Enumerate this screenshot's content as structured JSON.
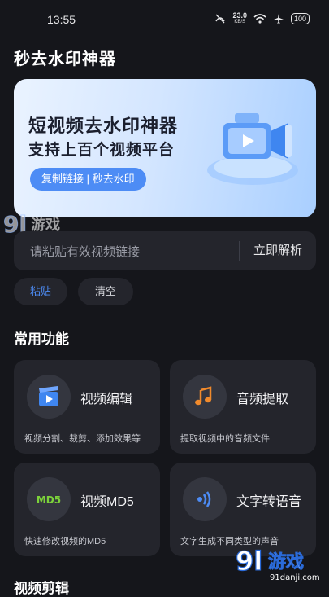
{
  "status_bar": {
    "time": "13:55",
    "speed_value": "23.0",
    "speed_unit": "KB/S",
    "battery": "100"
  },
  "app": {
    "title": "秒去水印神器"
  },
  "banner": {
    "headline": "短视频去水印神器",
    "subheadline": "支持上百个视频平台",
    "pill": "复制链接 | 秒去水印"
  },
  "watermark": {
    "brand": "9l游戏",
    "url": "91danji.com"
  },
  "url_input": {
    "placeholder": "请粘贴有效视频链接",
    "value": ""
  },
  "parse_button": "立即解析",
  "chips": {
    "paste": "粘贴",
    "clear": "清空"
  },
  "section_title": "常用功能",
  "features": [
    {
      "name": "视频编辑",
      "desc": "视频分割、裁剪、添加效果等",
      "icon": "clapperboard-play-icon"
    },
    {
      "name": "音频提取",
      "desc": "提取视频中的音频文件",
      "icon": "music-note-icon"
    },
    {
      "name": "视频MD5",
      "desc": "快速修改视频的MD5",
      "icon": "md5-badge-icon"
    },
    {
      "name": "文字转语音",
      "desc": "文字生成不同类型的声音",
      "icon": "sound-wave-icon"
    }
  ],
  "bottom_section_partial": "视频剪辑",
  "colors": {
    "background": "#15161b",
    "card": "#24252c",
    "accent": "#4d8cf5",
    "audio_orange": "#f08a2c",
    "md5_green": "#7cd23a"
  }
}
